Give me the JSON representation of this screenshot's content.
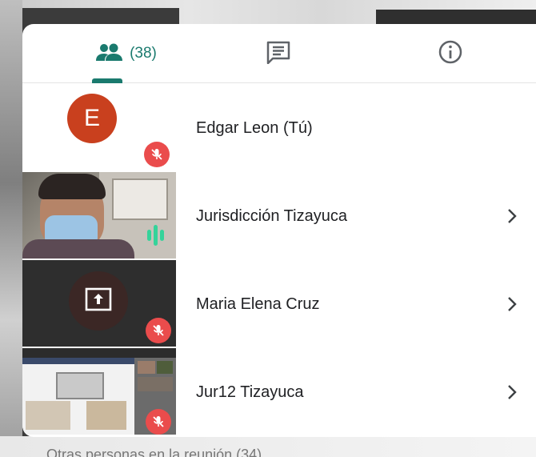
{
  "tabs": {
    "people_count": "(38)",
    "people_icon": "people-icon",
    "chat_icon": "chat-icon",
    "info_icon": "info-icon"
  },
  "participants": [
    {
      "name": "Edgar Leon (Tú)",
      "avatar_letter": "E",
      "muted": true
    },
    {
      "name": "Jurisdicción Tizayuca",
      "speaking": true
    },
    {
      "name": "Maria Elena Cruz",
      "presenting": true,
      "muted": true
    },
    {
      "name": "Jur12 Tizayuca",
      "muted": true
    }
  ],
  "others_label": "Otras personas en la reunión (34)",
  "colors": {
    "accent": "#1a7a6e",
    "avatar": "#c9401e",
    "muted_badge": "#ea4c4c",
    "speaking": "#35d39a"
  }
}
